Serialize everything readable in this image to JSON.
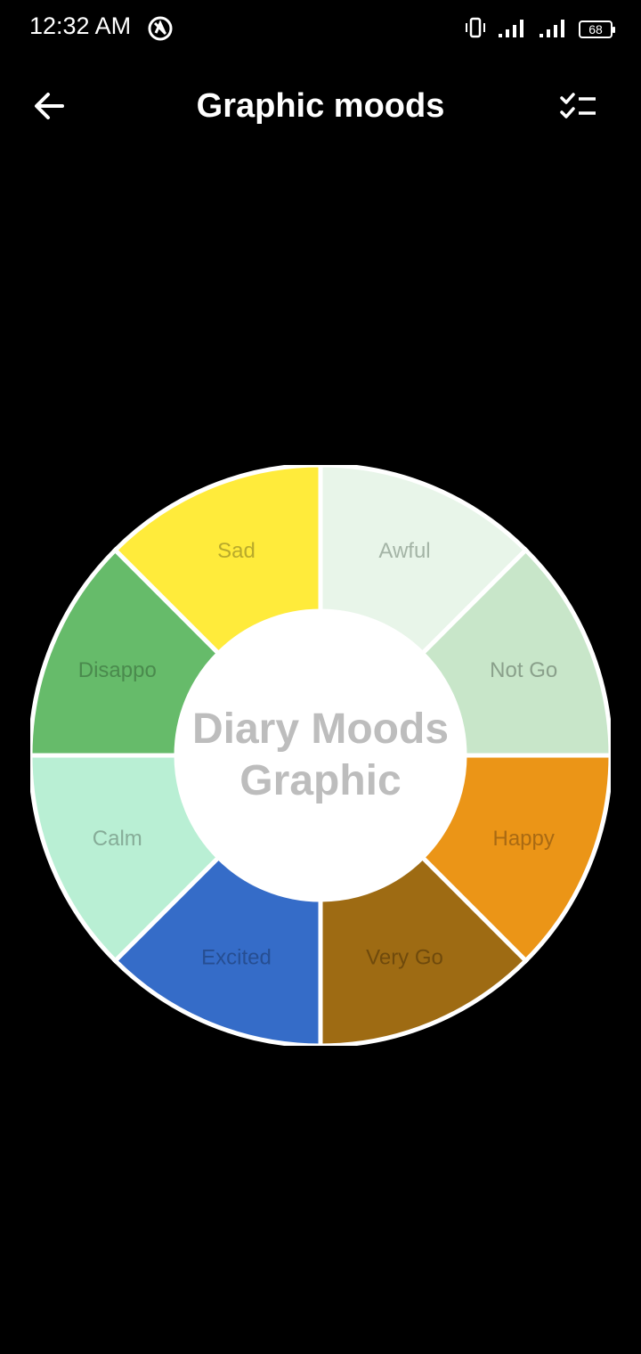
{
  "status_bar": {
    "time": "12:32 AM",
    "battery": "68",
    "icons": [
      "app-notification-icon",
      "vibrate-icon",
      "signal-icon",
      "signal-icon",
      "battery-icon"
    ]
  },
  "app_bar": {
    "title": "Graphic moods",
    "back_icon": "arrow-left-icon",
    "action_icon": "checklist-icon"
  },
  "center": {
    "line1": "Diary Moods",
    "line2": "Graphic"
  },
  "chart_data": {
    "type": "pie",
    "title": "Diary Moods Graphic",
    "slices": [
      {
        "label": "Awful",
        "value": 1,
        "color": "#E8F5E9",
        "label_color": "#a4b4a6"
      },
      {
        "label": "Not Go",
        "value": 1,
        "color": "#C8E6C9",
        "label_color": "#8aa08b"
      },
      {
        "label": "Happy",
        "value": 1,
        "color": "#EB9517",
        "label_color": "#a96a13"
      },
      {
        "label": "Very Go",
        "value": 1,
        "color": "#9E6B13",
        "label_color": "#6f4a0c"
      },
      {
        "label": "Excited",
        "value": 1,
        "color": "#356CC8",
        "label_color": "#264e92"
      },
      {
        "label": "Calm",
        "value": 1,
        "color": "#B9EFD4",
        "label_color": "#86ac98"
      },
      {
        "label": "Disappo",
        "value": 1,
        "color": "#66BB6A",
        "label_color": "#4a8a4d"
      },
      {
        "label": "Sad",
        "value": 1,
        "color": "#FFEB3B",
        "label_color": "#b9aa2b"
      }
    ]
  }
}
